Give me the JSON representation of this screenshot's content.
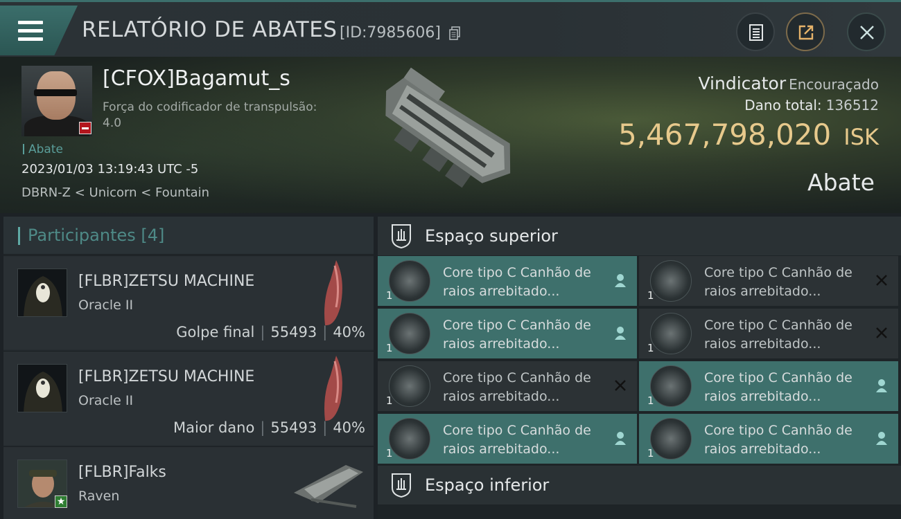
{
  "header": {
    "title": "RELATÓRIO DE ABATES",
    "report_id": "[ID:7985606]"
  },
  "victim": {
    "pilot": "[CFOX]Bagamut_s",
    "warp_label": "Força do codificador de transpulsão:",
    "warp_value": "4.0",
    "tag": "Abate",
    "datetime": "2023/01/03 13:19:43 UTC -5",
    "location": "DBRN-Z < Unicorn < Fountain",
    "ship": "Vindicator",
    "ship_class": "Encouraçado",
    "damage_label": "Dano total:",
    "damage_value": "136512",
    "isk_value": "5,467,798,020",
    "isk_unit": "ISK",
    "kill_type": "Abate"
  },
  "participants": {
    "title": "Participantes",
    "count": "[4]",
    "items": [
      {
        "name": "[FLBR]ZETSU MACHINE",
        "ship": "Oracle II",
        "role": "Golpe final",
        "damage": "55493",
        "percent": "40%"
      },
      {
        "name": "[FLBR]ZETSU MACHINE",
        "ship": "Oracle II",
        "role": "Maior dano",
        "damage": "55493",
        "percent": "40%"
      },
      {
        "name": "[FLBR]Falks",
        "ship": "Raven"
      }
    ]
  },
  "sections": {
    "upper_title": "Espaço superior",
    "lower_title": "Espaço inferior",
    "modules": [
      {
        "qty": "1",
        "line1": "Core tipo C Canhão de",
        "line2": "raios arrebitado...",
        "status": "dropped"
      },
      {
        "qty": "1",
        "line1": "Core tipo C Canhão de",
        "line2": "raios arrebitado...",
        "status": "destroyed"
      },
      {
        "qty": "1",
        "line1": "Core tipo C Canhão de",
        "line2": "raios arrebitado...",
        "status": "dropped"
      },
      {
        "qty": "1",
        "line1": "Core tipo C Canhão de",
        "line2": "raios arrebitado...",
        "status": "destroyed"
      },
      {
        "qty": "1",
        "line1": "Core tipo C Canhão de",
        "line2": "raios arrebitado...",
        "status": "destroyed"
      },
      {
        "qty": "1",
        "line1": "Core tipo C Canhão de",
        "line2": "raios arrebitado...",
        "status": "dropped"
      },
      {
        "qty": "1",
        "line1": "Core tipo C Canhão de",
        "line2": "raios arrebitado...",
        "status": "dropped"
      },
      {
        "qty": "1",
        "line1": "Core tipo C Canhão de",
        "line2": "raios arrebitado...",
        "status": "dropped"
      }
    ]
  },
  "colors": {
    "accent_teal": "#3e706c",
    "isk_gold": "#e7c98c",
    "badge_red": "#b3161e"
  }
}
